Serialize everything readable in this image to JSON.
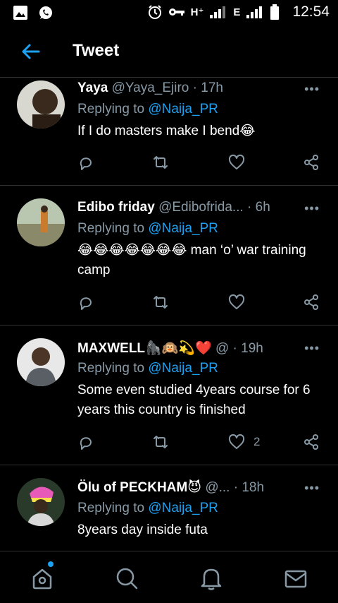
{
  "status_bar": {
    "left_icons": [
      "image-icon",
      "whatsapp-icon"
    ],
    "network_1": "H⁺",
    "network_2": "E",
    "time": "12:54"
  },
  "header": {
    "title": "Tweet"
  },
  "tweets": [
    {
      "name": "Yaya",
      "handle": "@Yaya_Ejiro",
      "time": "· 17h",
      "replying_prefix": "Replying to",
      "replying_to": "@Naija_PR",
      "text": "If I do masters make I bend😂",
      "like_count": ""
    },
    {
      "name": "Edibo friday",
      "handle": "@Edibofrida...",
      "time": "· 6h",
      "replying_prefix": "Replying to",
      "replying_to": "@Naija_PR",
      "text": "😂😂😂😂😂😂😂  man ‘o’ war training camp",
      "like_count": ""
    },
    {
      "name": "MAXWELL🦍🙉💫❤️",
      "handle": "@",
      "time": "· 19h",
      "replying_prefix": "Replying to",
      "replying_to": "@Naija_PR",
      "text": "Some even studied 4years course for 6 years this country is finished",
      "like_count": "2"
    },
    {
      "name": "Ölu of PECKHAM😈",
      "handle": "@...",
      "time": "· 18h",
      "replying_prefix": "Replying to",
      "replying_to": "@Naija_PR",
      "text": "8years day inside futa",
      "like_count": ""
    }
  ],
  "colors": {
    "accent": "#1da1f2",
    "muted": "#8899a6",
    "divider": "#2f3336"
  }
}
